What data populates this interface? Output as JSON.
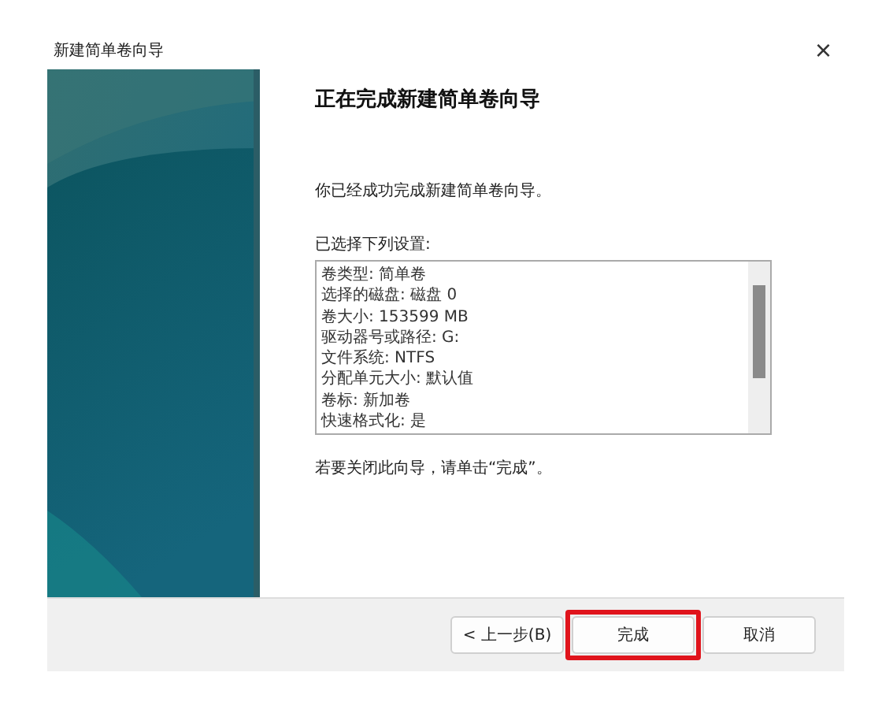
{
  "window": {
    "title": "新建简单卷向导",
    "close": "×"
  },
  "heading": "正在完成新建简单卷向导",
  "intro": "你已经成功完成新建简单卷向导。",
  "settings_label": "已选择下列设置:",
  "settings": [
    "卷类型: 简单卷",
    "选择的磁盘: 磁盘 0",
    "卷大小: 153599 MB",
    "驱动器号或路径: G:",
    "文件系统: NTFS",
    "分配单元大小: 默认值",
    "卷标: 新加卷",
    "快速格式化: 是"
  ],
  "closing_hint": "若要关闭此向导，请单击“完成”。",
  "buttons": [
    {
      "label": "< 上一步(B)",
      "highlighted": false
    },
    {
      "label": "完成",
      "highlighted": true
    },
    {
      "label": "取消",
      "highlighted": false
    }
  ]
}
